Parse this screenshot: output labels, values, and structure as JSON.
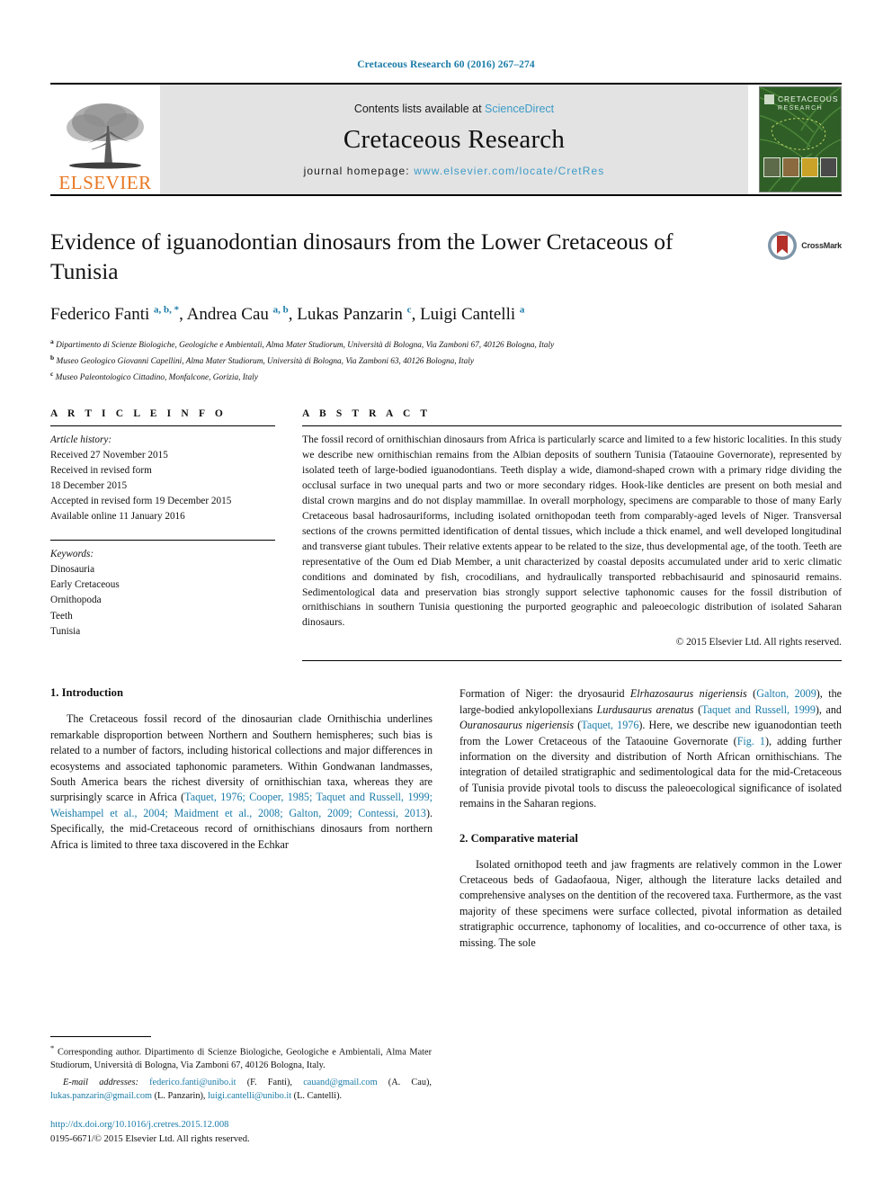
{
  "running_head": "Cretaceous Research 60 (2016) 267–274",
  "masthead": {
    "publisher_name": "ELSEVIER",
    "publisher_logo_icon": "elsevier-tree-icon",
    "contents_prefix": "Contents lists available at ",
    "contents_link": "ScienceDirect",
    "journal_name": "Cretaceous Research",
    "homepage_prefix": "journal homepage: ",
    "homepage_link": "www.elsevier.com/locate/CretRes",
    "cover_title_line1": "CRETACEOUS",
    "cover_title_line2": "RESEARCH"
  },
  "article": {
    "title": "Evidence of iguanodontian dinosaurs from the Lower Cretaceous of Tunisia",
    "crossmark_label": "CrossMark",
    "crossmark_icon": "crossmark-badge-icon",
    "authors_html": "Federico Fanti <sup>a, b, *</sup>, Andrea Cau <sup>a, b</sup>, Lukas Panzarin <sup>c</sup>, Luigi Cantelli <sup>a</sup>",
    "affiliations": [
      "Dipartimento di Scienze Biologiche, Geologiche e Ambientali, Alma Mater Studiorum, Università di Bologna, Via Zamboni 67, 40126 Bologna, Italy",
      "Museo Geologico Giovanni Capellini, Alma Mater Studiorum, Università di Bologna, Via Zamboni 63, 40126 Bologna, Italy",
      "Museo Paleontologico Cittadino, Monfalcone, Gorizia, Italy"
    ],
    "affil_marks": [
      "a",
      "b",
      "c"
    ]
  },
  "article_info": {
    "heading": "A R T I C L E  I N F O",
    "history_label": "Article history:",
    "history": [
      "Received 27 November 2015",
      "Received in revised form",
      "18 December 2015",
      "Accepted in revised form 19 December 2015",
      "Available online 11 January 2016"
    ],
    "keywords_label": "Keywords:",
    "keywords": [
      "Dinosauria",
      "Early Cretaceous",
      "Ornithopoda",
      "Teeth",
      "Tunisia"
    ]
  },
  "abstract": {
    "heading": "A B S T R A C T",
    "text": "The fossil record of ornithischian dinosaurs from Africa is particularly scarce and limited to a few historic localities. In this study we describe new ornithischian remains from the Albian deposits of southern Tunisia (Tataouine Governorate), represented by isolated teeth of large-bodied iguanodontians. Teeth display a wide, diamond-shaped crown with a primary ridge dividing the occlusal surface in two unequal parts and two or more secondary ridges. Hook-like denticles are present on both mesial and distal crown margins and do not display mammillae. In overall morphology, specimens are comparable to those of many Early Cretaceous basal hadrosauriforms, including isolated ornithopodan teeth from comparably-aged levels of Niger. Transversal sections of the crowns permitted identification of dental tissues, which include a thick enamel, and well developed longitudinal and transverse giant tubules. Their relative extents appear to be related to the size, thus developmental age, of the tooth. Teeth are representative of the Oum ed Diab Member, a unit characterized by coastal deposits accumulated under arid to xeric climatic conditions and dominated by fish, crocodilians, and hydraulically transported rebbachisaurid and spinosaurid remains. Sedimentological data and preservation bias strongly support selective taphonomic causes for the fossil distribution of ornithischians in southern Tunisia questioning the purported geographic and paleoecologic distribution of isolated Saharan dinosaurs.",
    "copyright": "© 2015 Elsevier Ltd. All rights reserved."
  },
  "sections": {
    "intro_heading": "1. Introduction",
    "intro_p1_a": "The Cretaceous fossil record of the dinosaurian clade Ornithischia underlines remarkable disproportion between Northern and Southern hemispheres; such bias is related to a number of factors, including historical collections and major differences in ecosystems and associated taphonomic parameters. Within Gondwanan landmasses, South America bears the richest diversity of ornithischian taxa, whereas they are surprisingly scarce in Africa (",
    "intro_p1_refs": "Taquet, 1976; Cooper, 1985; Taquet and Russell, 1999; Weishampel et al., 2004; Maidment et al., 2008; Galton, 2009; Contessi, 2013",
    "intro_p1_b": "). Specifically, the mid-Cretaceous record of ornithischians dinosaurs from northern Africa is limited to three taxa discovered in the Echkar",
    "intro_p2_a": "Formation of Niger: the dryosaurid ",
    "intro_p2_taxon1": "Elrhazosaurus nigeriensis",
    "intro_p2_b": " (",
    "intro_p2_ref1": "Galton, 2009",
    "intro_p2_c": "), the large-bodied ankylopollexians ",
    "intro_p2_taxon2": "Lurdusaurus arenatus",
    "intro_p2_d": " (",
    "intro_p2_ref2": "Taquet and Russell, 1999",
    "intro_p2_e": "), and ",
    "intro_p2_taxon3": "Ouranosaurus nigeriensis",
    "intro_p2_f": " (",
    "intro_p2_ref3": "Taquet, 1976",
    "intro_p2_g": "). Here, we describe new iguanodontian teeth from the Lower Cretaceous of the Tataouine Governorate (",
    "intro_p2_figref": "Fig. 1",
    "intro_p2_h": "), adding further information on the diversity and distribution of North African ornithischians. The integration of detailed stratigraphic and sedimentological data for the mid-Cretaceous of Tunisia provide pivotal tools to discuss the paleoecological significance of isolated remains in the Saharan regions.",
    "comparative_heading": "2. Comparative material",
    "comparative_p1": "Isolated ornithopod teeth and jaw fragments are relatively common in the Lower Cretaceous beds of Gadaofaoua, Niger, although the literature lacks detailed and comprehensive analyses on the dentition of the recovered taxa. Furthermore, as the vast majority of these specimens were surface collected, pivotal information as detailed stratigraphic occurrence, taphonomy of localities, and co-occurrence of other taxa, is missing. The sole"
  },
  "footnotes": {
    "corresponding_mark": "*",
    "corresponding": "Corresponding author. Dipartimento di Scienze Biologiche, Geologiche e Ambientali, Alma Mater Studiorum, Università di Bologna, Via Zamboni 67, 40126 Bologna, Italy.",
    "email_label": "E-mail addresses:",
    "emails": [
      {
        "address": "federico.fanti@unibo.it",
        "owner": "(F. Fanti),"
      },
      {
        "address": "cauand@gmail.com",
        "owner": "(A. Cau),"
      },
      {
        "address": "lukas.panzarin@gmail.com",
        "owner": "(L. Panzarin),"
      },
      {
        "address": "luigi.cantelli@unibo.it",
        "owner": "(L. Cantelli)."
      }
    ],
    "doi": "http://dx.doi.org/10.1016/j.cretres.2015.12.008",
    "issn": "0195-6671/© 2015 Elsevier Ltd. All rights reserved."
  },
  "colors": {
    "link": "#1a7ba8",
    "banner_link": "#3d9bc7",
    "elsevier_orange": "#E87722",
    "banner_bg": "#e3e3e3",
    "cover_green": "#2f5f27",
    "crossmark_red": "#b4312a"
  }
}
